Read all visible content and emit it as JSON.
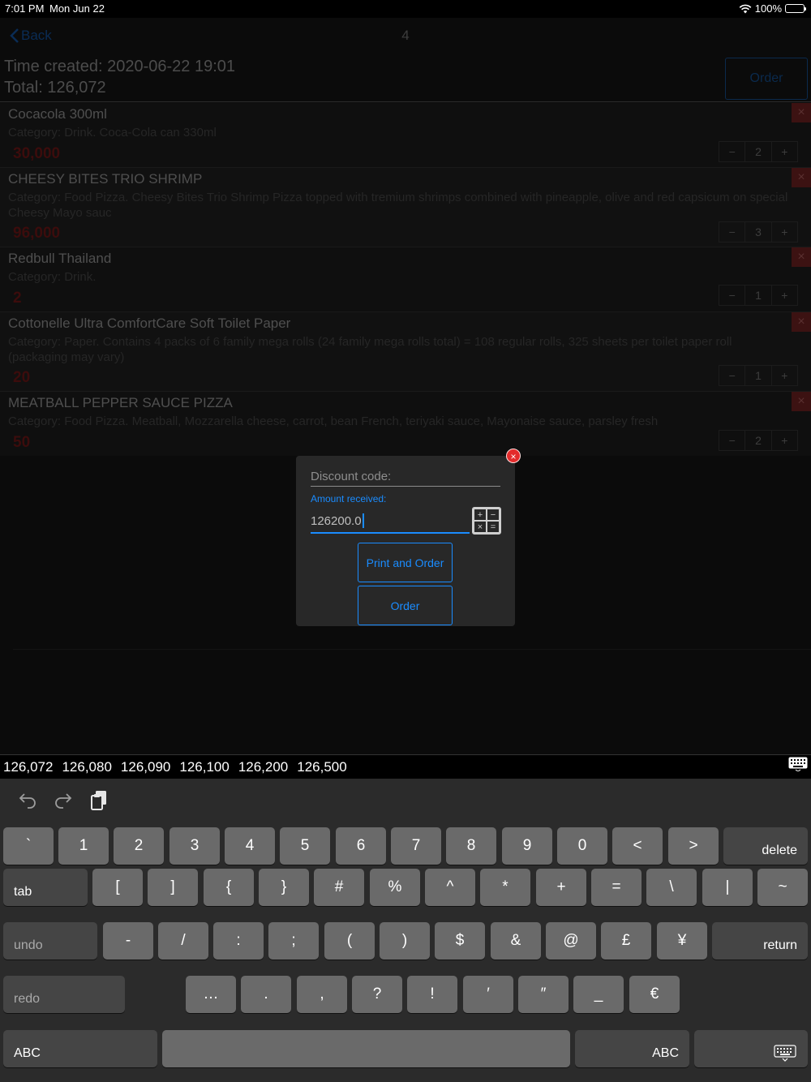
{
  "status": {
    "time": "7:01 PM",
    "date": "Mon Jun 22",
    "battery": "100%"
  },
  "nav": {
    "back": "Back",
    "title": "4"
  },
  "summary": {
    "time_created": "Time created: 2020-06-22 19:01",
    "total": "Total: 126,072",
    "order_button": "Order"
  },
  "items": [
    {
      "name": "Cocacola 300ml",
      "description": "Category: Drink. Coca-Cola can 330ml",
      "price": "30,000",
      "qty": "2"
    },
    {
      "name": "CHEESY BITES TRIO SHRIMP",
      "description": "Category: Food Pizza. Cheesy Bites Trio Shrimp Pizza topped with tremium shrimps combined with pineapple, olive and red capsicum on special Cheesy Mayo sauc",
      "price": "96,000",
      "qty": "3"
    },
    {
      "name": "Redbull Thailand",
      "description": "Category: Drink.",
      "price": "2",
      "qty": "1"
    },
    {
      "name": "Cottonelle Ultra ComfortCare Soft Toilet Paper",
      "description": "Category: Paper. Contains 4 packs of 6 family mega rolls (24 family mega rolls total) = 108 regular rolls, 325 sheets per toilet paper roll (packaging may vary)",
      "price": "20",
      "qty": "1"
    },
    {
      "name": "MEATBALL PEPPER SAUCE PIZZA",
      "description": "Category: Food Pizza. Meatball, Mozzarella cheese, carrot, bean French, teriyaki sauce, Mayonaise sauce, parsley fresh",
      "price": "50",
      "qty": "2"
    }
  ],
  "stepper": {
    "minus": "−",
    "plus": "+"
  },
  "dialog": {
    "discount_placeholder": "Discount code:",
    "amount_label": "Amount received:",
    "amount_value": "126200.0",
    "print_and_order": "Print and Order",
    "order": "Order",
    "close_icon": "×"
  },
  "suggestions": [
    "126,072",
    "126,080",
    "126,090",
    "126,100",
    "126,200",
    "126,500"
  ],
  "keyboard": {
    "row1": [
      "`",
      "1",
      "2",
      "3",
      "4",
      "5",
      "6",
      "7",
      "8",
      "9",
      "0",
      "<",
      ">"
    ],
    "delete": "delete",
    "tab": "tab",
    "row2": [
      "[",
      "]",
      "{",
      "}",
      "#",
      "%",
      "^",
      "*",
      "+",
      "=",
      "\\",
      "|",
      "~"
    ],
    "undo": "undo",
    "row3": [
      "-",
      "/",
      ":",
      ";",
      "(",
      ")",
      "$",
      "&",
      "@",
      "£",
      "¥"
    ],
    "return": "return",
    "redo": "redo",
    "row4": [
      "…",
      ".",
      ",",
      "?",
      "!",
      "′",
      "″",
      "_",
      "€"
    ],
    "abc_left": "ABC",
    "abc_right": "ABC"
  }
}
